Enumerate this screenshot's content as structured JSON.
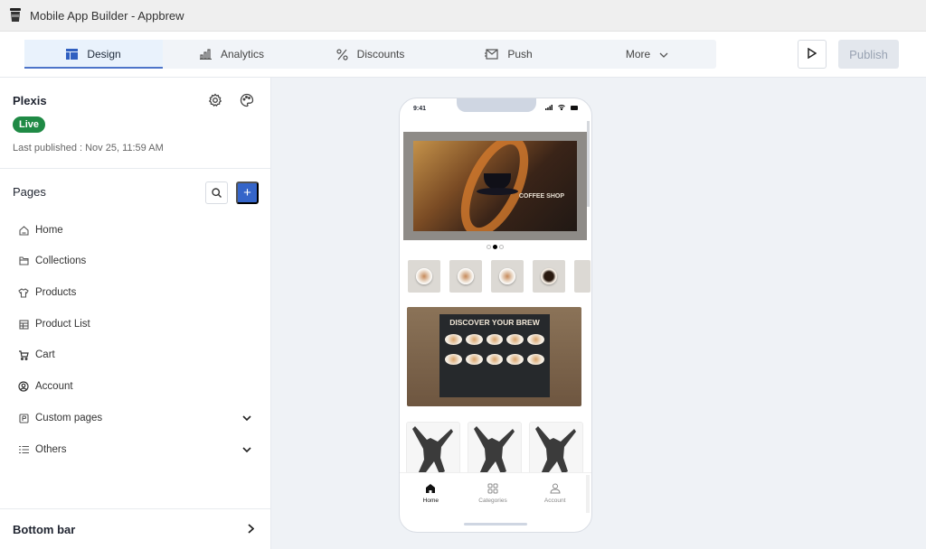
{
  "window": {
    "title": "Mobile App Builder - Appbrew"
  },
  "tabs": [
    {
      "label": "Design",
      "icon": "layout-icon",
      "active": true
    },
    {
      "label": "Analytics",
      "icon": "bar-chart-icon",
      "active": false
    },
    {
      "label": "Discounts",
      "icon": "percent-icon",
      "active": false
    },
    {
      "label": "Push",
      "icon": "mail-icon",
      "active": false
    },
    {
      "label": "More",
      "icon": "chevron-down-icon",
      "active": false
    }
  ],
  "toolbar": {
    "publish_label": "Publish",
    "preview_icon": "play-icon"
  },
  "store": {
    "name": "Plexis",
    "status": "Live",
    "last_published": "Last published : Nov 25, 11:59 AM"
  },
  "pages": {
    "title": "Pages",
    "items": [
      {
        "label": "Home",
        "icon": "home-icon"
      },
      {
        "label": "Collections",
        "icon": "folder-icon"
      },
      {
        "label": "Products",
        "icon": "shirt-icon"
      },
      {
        "label": "Product List",
        "icon": "table-icon"
      },
      {
        "label": "Cart",
        "icon": "cart-icon"
      },
      {
        "label": "Account",
        "icon": "user-circle-icon"
      },
      {
        "label": "Custom pages",
        "icon": "page-icon",
        "expandable": true
      },
      {
        "label": "Others",
        "icon": "list-icon",
        "expandable": true
      }
    ]
  },
  "bottom_bar": {
    "label": "Bottom bar"
  },
  "phone": {
    "time": "9:41",
    "banner_text": "COFFEE SHOP",
    "carousel": {
      "count": 3,
      "active": 2
    },
    "promo_title": "DISCOVER YOUR BREW",
    "nav": [
      {
        "label": "Home",
        "icon": "home-filled-icon",
        "active": true
      },
      {
        "label": "Categories",
        "icon": "grid-icon",
        "active": false
      },
      {
        "label": "Account",
        "icon": "user-icon",
        "active": false
      }
    ]
  },
  "colors": {
    "accent": "#3565c9",
    "live": "#1f8a45",
    "canvas": "#eff2f6"
  }
}
